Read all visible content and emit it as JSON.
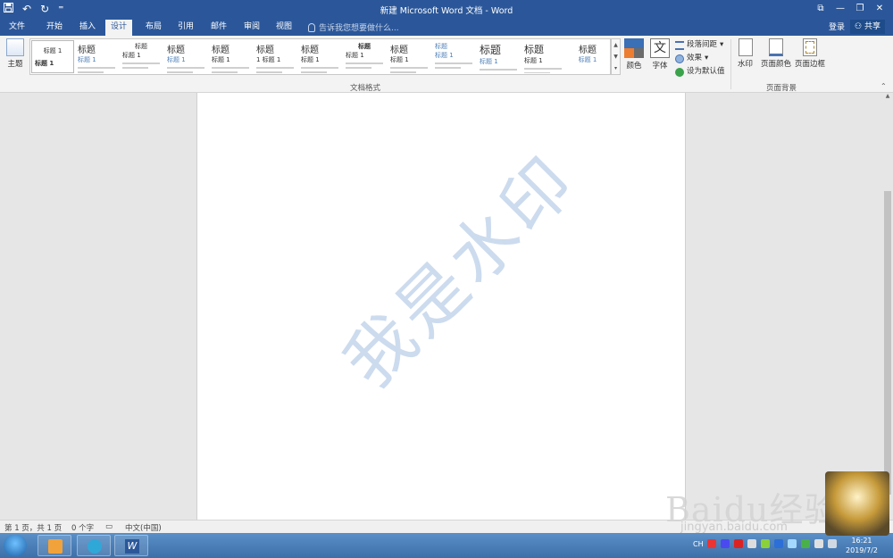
{
  "title_bar": {
    "title": "新建 Microsoft Word 文档 - Word",
    "qat": {
      "save_icon": "save-icon",
      "undo_icon": "undo-icon",
      "redo_icon": "redo-icon",
      "customize": "⁼"
    },
    "controls": {
      "restore": "⧉",
      "minimize": "—",
      "maximize": "❐",
      "close": "✕"
    }
  },
  "tabs": [
    {
      "label": "文件"
    },
    {
      "label": "开始"
    },
    {
      "label": "插入"
    },
    {
      "label": "设计",
      "active": true
    },
    {
      "label": "布局"
    },
    {
      "label": "引用"
    },
    {
      "label": "邮件"
    },
    {
      "label": "审阅"
    },
    {
      "label": "视图"
    }
  ],
  "tell_me": {
    "placeholder": "告诉我您想要做什么..."
  },
  "account": {
    "login": "登录",
    "share": "共享"
  },
  "ribbon": {
    "theme_label": "主题",
    "gallery_styles": [
      {
        "heading": "标题 1",
        "sub": "标题 1"
      },
      {
        "heading": "标题",
        "sub": "标题 1"
      },
      {
        "heading": "标题",
        "sub": "标题 1"
      },
      {
        "heading": "标题",
        "sub": "标题 1"
      },
      {
        "heading": "标题",
        "sub": "标题 1"
      },
      {
        "heading": "标题",
        "sub": "1 标题 1"
      },
      {
        "heading": "标题",
        "sub": "标题 1"
      },
      {
        "heading": "标题",
        "sub": "标题 1"
      },
      {
        "heading": "标题",
        "sub": "标题 1"
      },
      {
        "heading": "标题",
        "sub": "标题 1"
      },
      {
        "heading": "标题",
        "sub": "标题 1"
      },
      {
        "heading": "标题",
        "sub": "标题 1"
      },
      {
        "heading": "标题",
        "sub": "标题 1"
      }
    ],
    "document_format_group": "文档格式",
    "colors_label": "颜色",
    "fonts_label": "字体",
    "paragraph_spacing_label": "段落间距",
    "effects_label": "效果",
    "set_default_label": "设为默认值",
    "watermark_label": "水印",
    "page_color_label": "页面颜色",
    "page_borders_label": "页面边框",
    "page_background_group": "页面背景"
  },
  "document": {
    "watermark_text": "我是水印"
  },
  "status_bar": {
    "page": "第 1 页，共 1 页",
    "words": "0 个字",
    "language": "中文(中国)"
  },
  "taskbar": {
    "tray_lang": "CH",
    "time": "16:21",
    "date": "2019/7/2"
  },
  "overlay": {
    "baidu": "Baidu经验",
    "baidu_sub": "jingyan.baidu.com"
  }
}
